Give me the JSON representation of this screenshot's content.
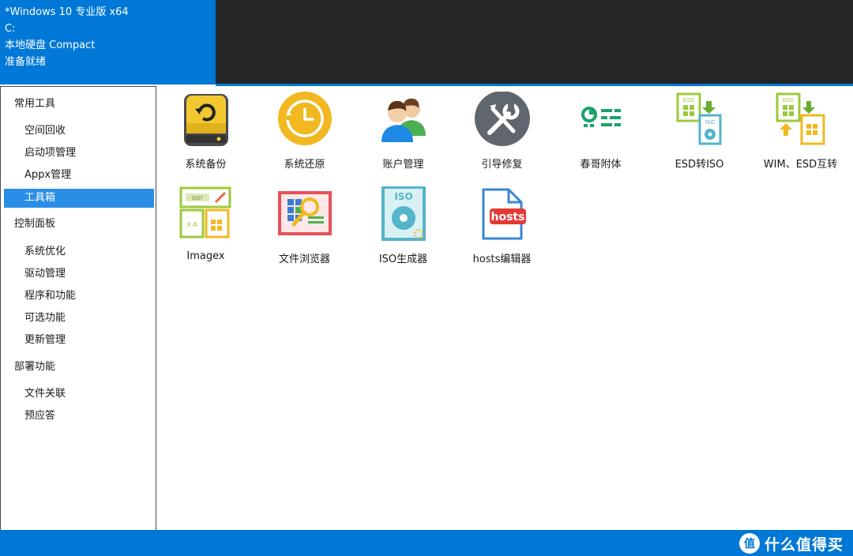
{
  "header": {
    "lines": [
      "*Windows 10 专业版 x64",
      "C:",
      "本地硬盘 Compact",
      "准备就绪"
    ]
  },
  "sidebar": {
    "sections": [
      {
        "title": "常用工具",
        "items": [
          "空间回收",
          "启动项管理",
          "Appx管理",
          "工具箱"
        ]
      },
      {
        "title": "控制面板",
        "items": [
          "系统优化",
          "驱动管理",
          "程序和功能",
          "可选功能",
          "更新管理"
        ]
      },
      {
        "title": "部署功能",
        "items": [
          "文件关联",
          "预应答"
        ]
      }
    ],
    "selected": "工具箱"
  },
  "tools": [
    {
      "label": "系统备份",
      "icon": "drive-backup-icon"
    },
    {
      "label": "系统还原",
      "icon": "clock-restore-icon"
    },
    {
      "label": "账户管理",
      "icon": "users-icon"
    },
    {
      "label": "引导修复",
      "icon": "wrench-screwdriver-icon"
    },
    {
      "label": "春哥附体",
      "icon": "settings-list-icon"
    },
    {
      "label": "ESD转ISO",
      "icon": "esd-to-iso-icon"
    },
    {
      "label": "WIM、ESD互转",
      "icon": "wim-esd-convert-icon"
    },
    {
      "label": "Imagex",
      "icon": "imagex-edit-icon"
    },
    {
      "label": "文件浏览器",
      "icon": "file-browser-search-icon"
    },
    {
      "label": "ISO生成器",
      "icon": "iso-disc-icon"
    },
    {
      "label": "hosts编辑器",
      "icon": "hosts-file-icon"
    }
  ],
  "icon_glyphs": {
    "esd": "ESD",
    "iso": "ISO",
    "edit": "EDIT",
    "hosts": "hosts",
    "xa": "X·A"
  },
  "watermark": {
    "badge": "值",
    "text": "什么值得买"
  },
  "colors": {
    "accent": "#0078d7",
    "selected": "#2b8ee6",
    "dark": "#252525"
  }
}
